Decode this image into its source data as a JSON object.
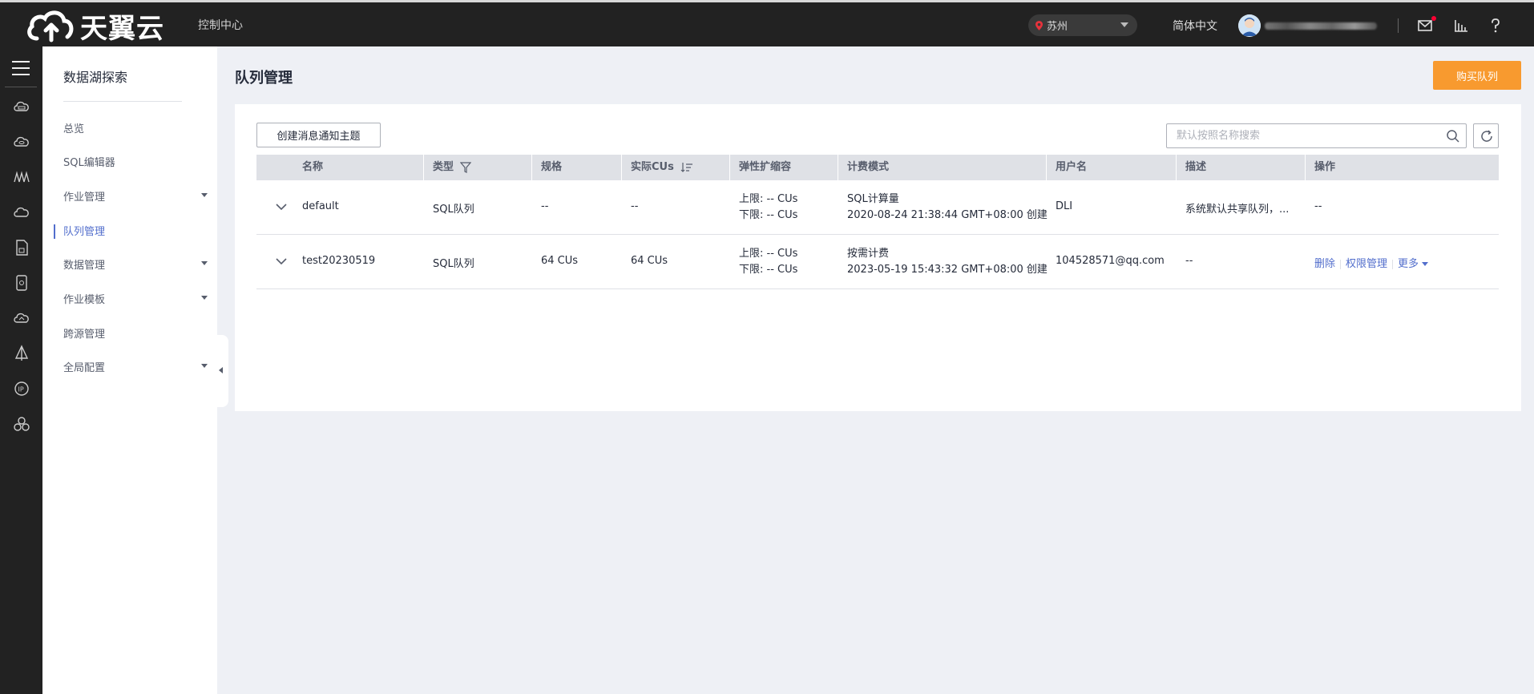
{
  "header": {
    "brand": "天翼云",
    "console_link": "控制中心",
    "region": "苏州",
    "language": "简体中文",
    "icons": [
      "mail-icon",
      "chart-icon",
      "help-icon"
    ]
  },
  "rail": {
    "icons": [
      "menu-icon",
      "cloud-server-icon",
      "cloud-db-icon",
      "container-icon",
      "cloud-storage-icon",
      "document-icon",
      "device-icon",
      "cloud-sync-icon",
      "sail-icon",
      "ip-icon",
      "cluster-icon"
    ]
  },
  "sidebar": {
    "title": "数据湖探索",
    "items": [
      {
        "label": "总览",
        "has_children": false,
        "active": false
      },
      {
        "label": "SQL编辑器",
        "has_children": false,
        "active": false
      },
      {
        "label": "作业管理",
        "has_children": true,
        "active": false
      },
      {
        "label": "队列管理",
        "has_children": false,
        "active": true
      },
      {
        "label": "数据管理",
        "has_children": true,
        "active": false
      },
      {
        "label": "作业模板",
        "has_children": true,
        "active": false
      },
      {
        "label": "跨源管理",
        "has_children": false,
        "active": false
      },
      {
        "label": "全局配置",
        "has_children": true,
        "active": false
      }
    ]
  },
  "main": {
    "page_title": "队列管理",
    "buy_button": "购买队列",
    "create_button": "创建消息通知主题",
    "search_placeholder": "默认按照名称搜索",
    "table": {
      "columns": [
        "名称",
        "类型",
        "规格",
        "实际CUs",
        "弹性扩缩容",
        "计费模式",
        "用户名",
        "描述",
        "操作"
      ],
      "rows": [
        {
          "name": "default",
          "type": "SQL队列",
          "spec": "--",
          "actual_cus": "--",
          "scale_upper": "上限: -- CUs",
          "scale_lower": "下限: -- CUs",
          "billing_mode": "SQL计算量",
          "billing_time": "2020-08-24 21:38:44 GMT+08:00 创建",
          "user": "DLI",
          "description": "系统默认共享队列，...",
          "ops_text": "--"
        },
        {
          "name": "test20230519",
          "type": "SQL队列",
          "spec": "64 CUs",
          "actual_cus": "64 CUs",
          "scale_upper": "上限: -- CUs",
          "scale_lower": "下限: -- CUs",
          "billing_mode": "按需计费",
          "billing_time": "2023-05-19 15:43:32 GMT+08:00 创建",
          "user": "104528571@qq.com",
          "description": "--",
          "ops": [
            "删除",
            "权限管理",
            "更多"
          ]
        }
      ]
    }
  },
  "colors": {
    "accent": "#526ecc",
    "buy_button": "#f89a2f",
    "topbar": "#222222"
  }
}
